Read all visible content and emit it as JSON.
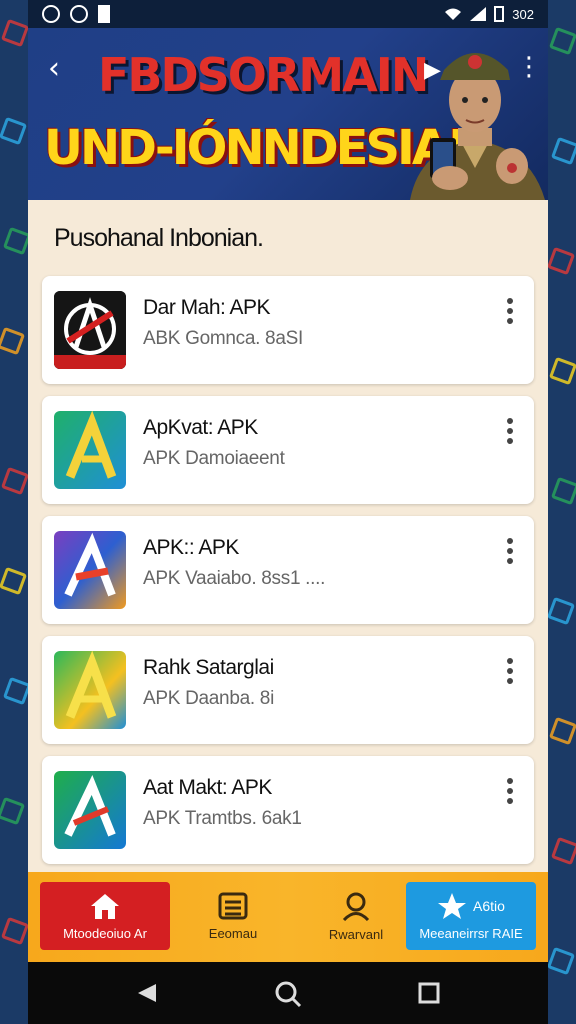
{
  "status_bar": {
    "time": "302"
  },
  "banner": {
    "title_line1": "FBDSORMAIN",
    "title_line2": "UND-IÓNNDESIA!"
  },
  "section": {
    "title": "Pusohanal Inbonian."
  },
  "apps": [
    {
      "name": "Dar Mah: APK",
      "subtitle": "ABK Gomnca. 8aSI"
    },
    {
      "name": "ApKvat: APK",
      "subtitle": "APK Damoiaeent"
    },
    {
      "name": "APK:: APK",
      "subtitle": "APK Vaaiabo. 8ss1 ...."
    },
    {
      "name": "Rahk Satarglai",
      "subtitle": "APK Daanba. 8i"
    },
    {
      "name": "Aat Makt: APK",
      "subtitle": "APK Tramtbs. 6ak1"
    }
  ],
  "bottom_nav": [
    {
      "label": "Mtoodeoiuo Ar"
    },
    {
      "label": "Eeomau"
    },
    {
      "label": "Rwarvanl"
    },
    {
      "label": "Meeaneirrsr RAIE",
      "badge": "A6tio"
    }
  ],
  "colors": {
    "banner_bg": "#22408a",
    "content_bg": "#f6ead8",
    "nav_bg": "#f7a81c",
    "nav_active_red": "#d41f22",
    "nav_active_blue": "#1e9ae0"
  }
}
